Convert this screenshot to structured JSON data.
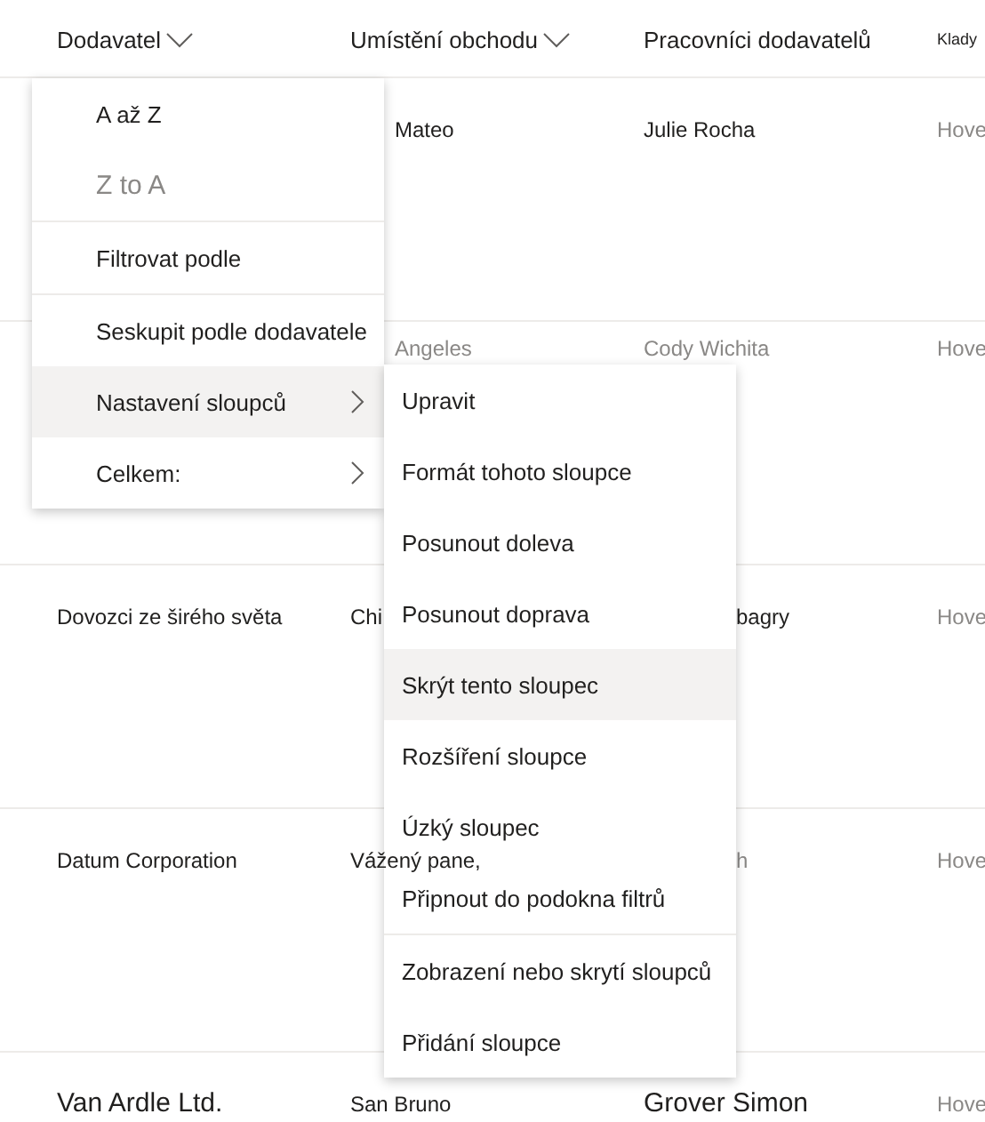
{
  "columns": [
    {
      "label": "Dodavatel",
      "kind": "dropdown"
    },
    {
      "label": "Umístění obchodu",
      "kind": "dropdown"
    },
    {
      "label": "Pracovníci dodavatelů",
      "kind": "plain"
    },
    {
      "label": "Klady",
      "kind": "small"
    }
  ],
  "rows": [
    [
      {
        "text": "",
        "kind": "plain"
      },
      {
        "text": "Mateo",
        "kind": "cut"
      },
      {
        "text": "Julie Rocha",
        "kind": "plain"
      },
      {
        "text": "Hove",
        "kind": "muted"
      }
    ],
    [
      {
        "text": "",
        "kind": "plain"
      },
      {
        "text": "Angeles",
        "kind": "cut_muted"
      },
      {
        "text": "Cody Wichita",
        "kind": "muted"
      },
      {
        "text": "Hove",
        "kind": "muted"
      }
    ],
    [
      {
        "text": "Dovozci ze širého světa",
        "kind": "plain"
      },
      {
        "text": "Chi",
        "kind": "plain"
      },
      {
        "text": "bagry",
        "kind": "cut"
      },
      {
        "text": "Hove",
        "kind": "muted"
      }
    ],
    [
      {
        "text": "Datum Corporation",
        "kind": "plain"
      },
      {
        "text": "Vážený pane,",
        "kind": "overlay"
      },
      {
        "text": "h",
        "kind": "cut_muted"
      },
      {
        "text": "Hove",
        "kind": "muted"
      }
    ],
    [
      {
        "text": "Van Ardle Ltd.",
        "kind": "large"
      },
      {
        "text": "San Bruno",
        "kind": "plain"
      },
      {
        "text": "Grover Simon",
        "kind": "large"
      },
      {
        "text": "Hove",
        "kind": "muted"
      }
    ]
  ],
  "column_menu": [
    {
      "label": "A až Z",
      "selected": false,
      "disabled": false,
      "submenu": false,
      "divider_before": false
    },
    {
      "label": "Z to A",
      "selected": false,
      "disabled": true,
      "submenu": false,
      "divider_before": false
    },
    {
      "label": "Filtrovat podle",
      "selected": false,
      "disabled": false,
      "submenu": false,
      "divider_before": true
    },
    {
      "label": "Seskupit podle dodavatele",
      "selected": false,
      "disabled": false,
      "submenu": false,
      "divider_before": true
    },
    {
      "label": "Nastavení sloupců",
      "selected": true,
      "disabled": false,
      "submenu": true,
      "divider_before": false
    },
    {
      "label": "Celkem:",
      "selected": false,
      "disabled": false,
      "submenu": true,
      "divider_before": false
    }
  ],
  "column_settings_menu": [
    {
      "label": "Upravit",
      "selected": false,
      "divider_before": false
    },
    {
      "label": "Formát tohoto sloupce",
      "selected": false,
      "divider_before": false
    },
    {
      "label": "Posunout doleva",
      "selected": false,
      "divider_before": false
    },
    {
      "label": "Posunout doprava",
      "selected": false,
      "divider_before": false
    },
    {
      "label": "Skrýt tento sloupec",
      "selected": true,
      "divider_before": false
    },
    {
      "label": "Rozšíření sloupce",
      "selected": false,
      "divider_before": false
    },
    {
      "label": "Úzký sloupec",
      "selected": false,
      "divider_before": false
    },
    {
      "label": "Připnout do podokna filtrů",
      "selected": false,
      "divider_before": false
    },
    {
      "label": "Zobrazení nebo skrytí sloupců",
      "selected": false,
      "divider_before": true
    },
    {
      "label": "Přidání sloupce",
      "selected": false,
      "divider_before": false
    }
  ]
}
